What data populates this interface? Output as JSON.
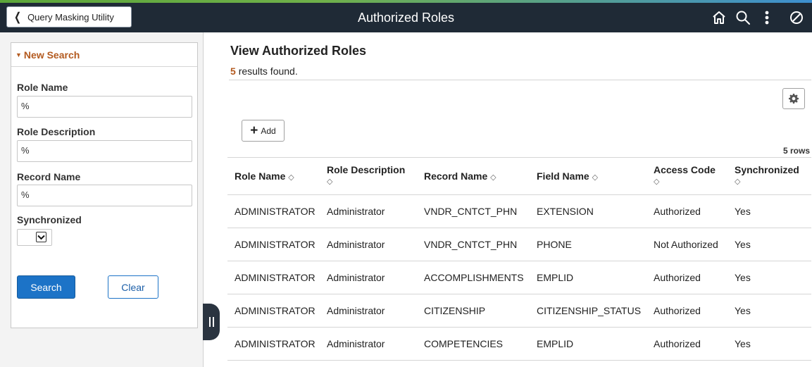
{
  "header": {
    "back_label": "Query Masking Utility",
    "title": "Authorized Roles",
    "icons": [
      "home-icon",
      "search-icon",
      "actions-menu-icon",
      "navbar-icon"
    ]
  },
  "search_panel": {
    "title": "New Search",
    "fields": [
      {
        "label": "Role Name",
        "value": "%"
      },
      {
        "label": "Role Description",
        "value": "%"
      },
      {
        "label": "Record Name",
        "value": "%"
      }
    ],
    "synchronized_label": "Synchronized",
    "synchronized_value": "",
    "search_label": "Search",
    "clear_label": "Clear"
  },
  "main": {
    "title": "View Authorized Roles",
    "result_count": "5",
    "result_text": "results found.",
    "add_label": "Add",
    "row_count": "5 rows",
    "columns": [
      "Role Name",
      "Role Description",
      "Record Name",
      "Field Name",
      "Access Code",
      "Synchronized"
    ],
    "rows": [
      [
        "ADMINISTRATOR",
        "Administrator",
        "VNDR_CNTCT_PHN",
        "EXTENSION",
        "Authorized",
        "Yes"
      ],
      [
        "ADMINISTRATOR",
        "Administrator",
        "VNDR_CNTCT_PHN",
        "PHONE",
        "Not Authorized",
        "Yes"
      ],
      [
        "ADMINISTRATOR",
        "Administrator",
        "ACCOMPLISHMENTS",
        "EMPLID",
        "Authorized",
        "Yes"
      ],
      [
        "ADMINISTRATOR",
        "Administrator",
        "CITIZENSHIP",
        "CITIZENSHIP_STATUS",
        "Authorized",
        "Yes"
      ],
      [
        "ADMINISTRATOR",
        "Administrator",
        "COMPETENCIES",
        "EMPLID",
        "Authorized",
        "Yes"
      ]
    ]
  },
  "colors": {
    "header_bg": "#1f2a36",
    "accent_orange": "#b35a1f",
    "primary_blue": "#1c73c7"
  }
}
